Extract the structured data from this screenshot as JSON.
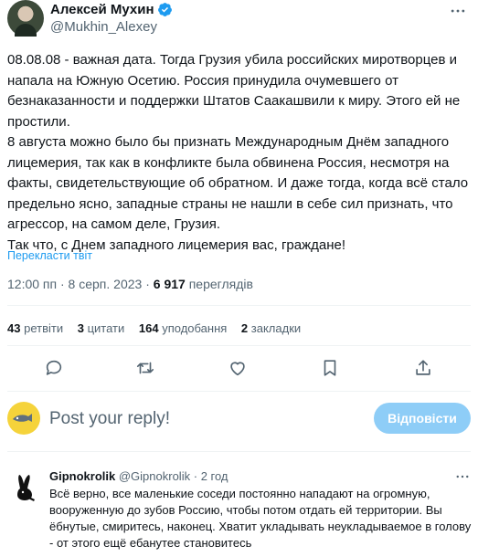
{
  "author": {
    "name": "Алексей Мухин",
    "handle": "@Mukhin_Alexey"
  },
  "tweet": {
    "paragraphs": [
      "08.08.08 - важная дата. Тогда Грузия убила российских миротворцев и напала на Южную Осетию. Россия принудила очумевшего от безнаказанности и поддержки Штатов Саакашвили к миру. Этого ей не простили.",
      "8 августа можно было бы признать Международным Днём западного лицемерия, так как в конфликте была обвинена Россия, несмотря на факты, свидетельствующие об обратном. И даже тогда, когда всё стало предельно ясно, западные страны не нашли в себе сил признать, что агрессор, на самом деле, Грузия.",
      "Так что, с Днем западного лицемерия вас, граждане!"
    ],
    "translate_label": "Перекласти твіт",
    "time": "12:00 пп",
    "separator": "·",
    "date": "8 серп. 2023",
    "views_count": "6 917",
    "views_label": "переглядів"
  },
  "stats": [
    {
      "count": "43",
      "label": "ретвіти"
    },
    {
      "count": "3",
      "label": "цитати"
    },
    {
      "count": "164",
      "label": "уподобання"
    },
    {
      "count": "2",
      "label": "закладки"
    }
  ],
  "actions": [
    {
      "icon": "reply-icon"
    },
    {
      "icon": "retweet-icon"
    },
    {
      "icon": "like-icon"
    },
    {
      "icon": "bookmark-icon"
    },
    {
      "icon": "share-icon"
    }
  ],
  "compose": {
    "placeholder": "Post your reply!",
    "button_label": "Відповісти"
  },
  "reply": {
    "name": "Gipnokrolik",
    "handle": "@Gipnokrolik",
    "separator": "·",
    "time": "2 год",
    "text": "Всё верно, все маленькие соседи постоянно нападают на огромную, вооруженную до зубов Россию, чтобы потом отдать ей территории. Вы ёбнутые, смиритесь, наконец. Хватит укладывать неукладываемое в голову - от этого ещё ебанутее становитесь"
  },
  "colors": {
    "accent": "#1d9bf0",
    "button_disabled": "#8ecdf7",
    "secondary_text": "#536471",
    "divider": "#eff3f4"
  }
}
